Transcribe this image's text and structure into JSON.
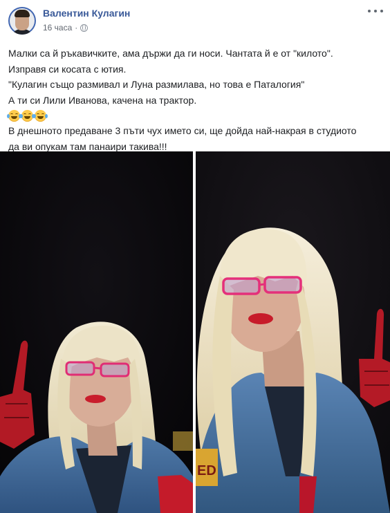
{
  "post": {
    "author": "Валентин Кулагин",
    "time": "16 часа",
    "separator": "·",
    "privacy_icon": "globe-icon",
    "more_icon": "more-options-icon",
    "lines": [
      "Малки са й ръкавичките, ама държи да ги носи. Чантата й е от \"килото\".",
      "Изправя си косата с ютия.",
      "\"Кулагин също размивал и Луна размилава, но това е Паталогия\"",
      "А ти си Лили Иванова, качена на трактор."
    ],
    "emoji": [
      "face-with-tears-of-joy-emoji",
      "face-with-tears-of-joy-emoji",
      "face-with-tears-of-joy-emoji"
    ],
    "lines_after": [
      "В днешното предаване 3 пъти чух името си, ще дойда най-накрая в студиото",
      "да ви опукам там панаири такива!!!"
    ]
  },
  "photos": [
    {
      "name": "photo-left",
      "description_icon": "tv-screenshot-photo"
    },
    {
      "name": "photo-right",
      "description_icon": "tv-screenshot-photo",
      "overlay_text": "ED"
    }
  ],
  "colors": {
    "author_link": "#385898",
    "meta_text": "#616770",
    "body_text": "#1c1e21"
  }
}
